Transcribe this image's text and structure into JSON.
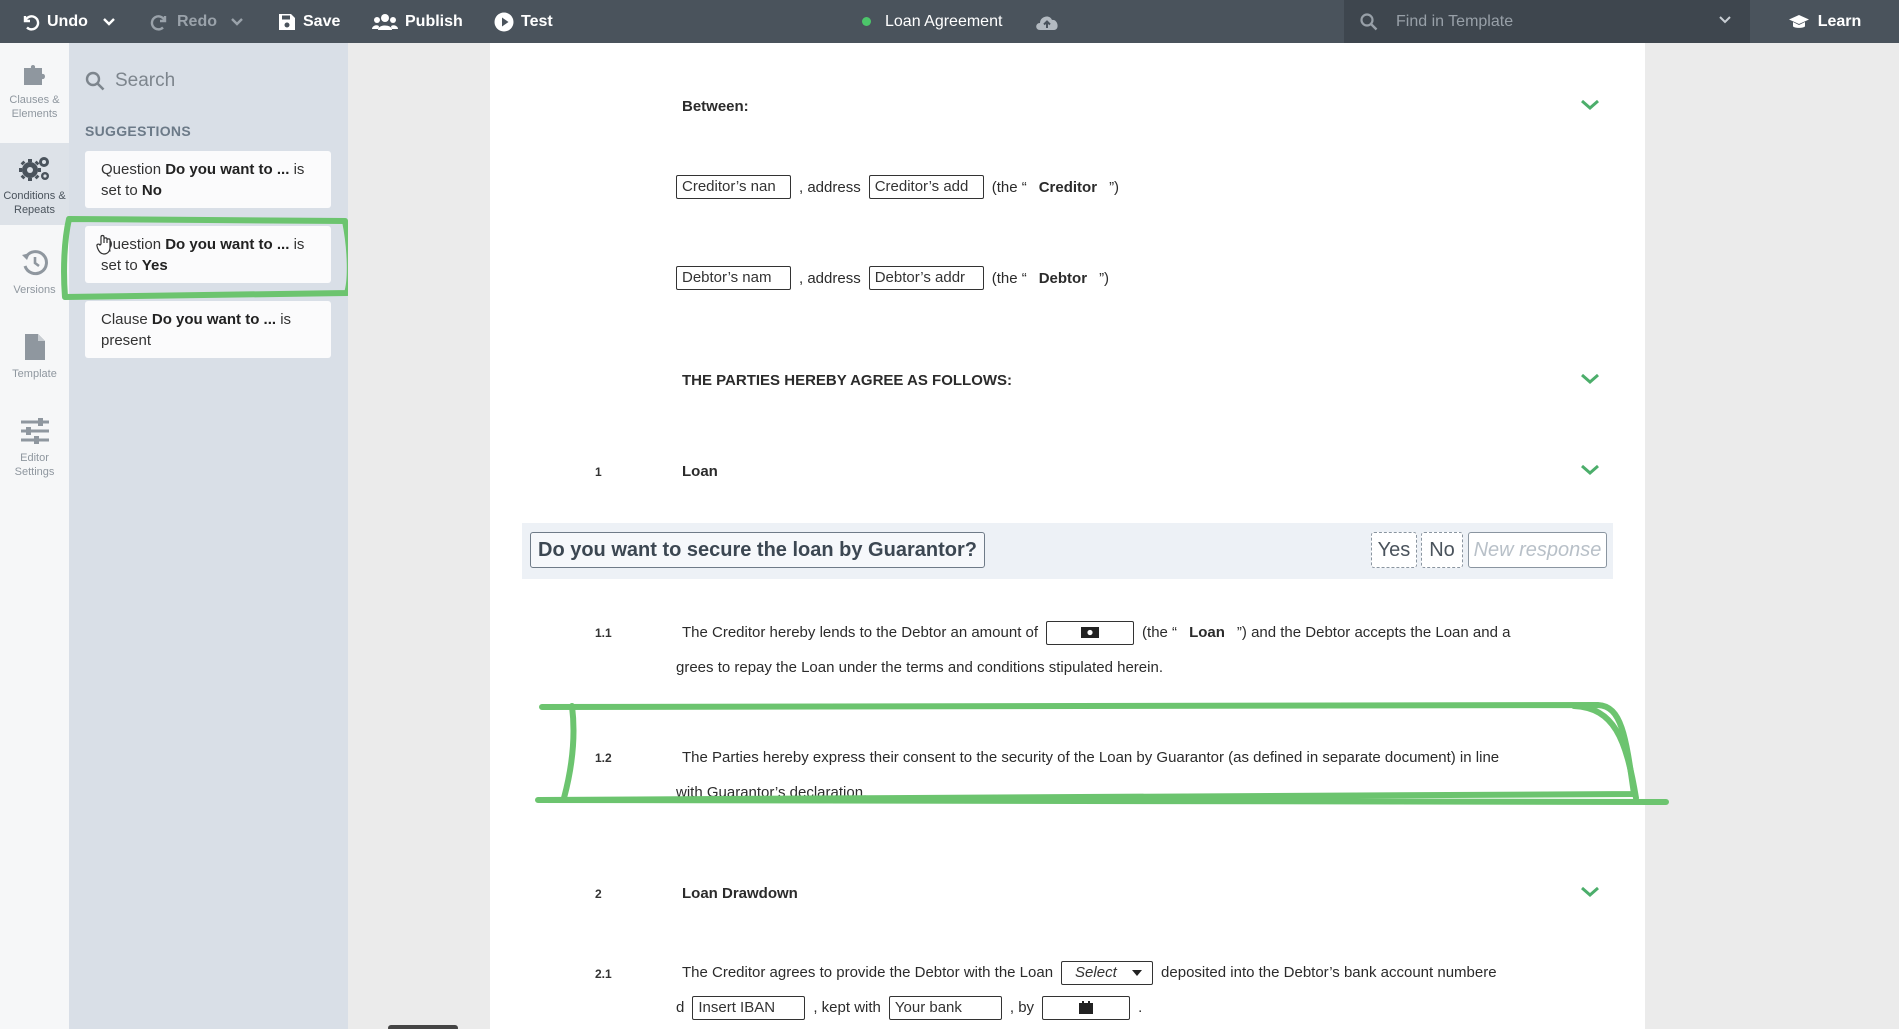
{
  "toolbar": {
    "undo": "Undo",
    "redo": "Redo",
    "save": "Save",
    "publish": "Publish",
    "test": "Test",
    "document_title": "Loan Agreement",
    "find_placeholder": "Find in Template",
    "learn": "Learn"
  },
  "rail": {
    "clauses": "Clauses & Elements",
    "conditions": "Conditions & Repeats",
    "versions": "Versions",
    "template": "Template",
    "editor_settings": "Editor Settings"
  },
  "panel": {
    "search_placeholder": "Search",
    "heading": "SUGGESTIONS",
    "suggestions": [
      {
        "kind": "Question",
        "subject": "Do you want to ...",
        "verb": "is set to",
        "value": "No"
      },
      {
        "kind": "Question",
        "subject": "Do you want to ...",
        "verb": "is set to",
        "value": "Yes"
      },
      {
        "kind": "Clause",
        "subject": "Do you want to ...",
        "verb": "is present",
        "value": ""
      }
    ]
  },
  "document": {
    "between": "Between:",
    "creditor_line": {
      "name_field": "Creditor’s nan",
      "address_label": ", address",
      "address_field": "Creditor’s add",
      "the_open": "(the “",
      "role": "Creditor",
      "the_close": "”)"
    },
    "debtor_line": {
      "name_field": "Debtor’s nam",
      "address_label": ", address",
      "address_field": "Debtor’s addr",
      "the_open": "(the “",
      "role": "Debtor",
      "the_close": "”)"
    },
    "parties_heading": "THE PARTIES HEREBY AGREE AS FOLLOWS:",
    "s1_number": "1",
    "s1_title": "Loan",
    "question": "Do you want to secure the loan by Guarantor?",
    "answer_yes": "Yes",
    "answer_no": "No",
    "answer_new": "New response",
    "c11_number": "1.1",
    "c11_a": "The Creditor hereby lends to the Debtor an amount of",
    "c11_b": "(the “",
    "c11_loan": "Loan",
    "c11_c": "”) and the Debtor accepts the Loan and a",
    "c11_d": "grees to repay the Loan under the terms and conditions stipulated herein.",
    "c12_number": "1.2",
    "c12_a": "The Parties hereby express their consent to the security of the Loan by Guarantor (as defined in separate document) in line",
    "c12_b": "with Guarantor’s declaration.",
    "s2_number": "2",
    "s2_title": "Loan Drawdown",
    "c21_number": "2.1",
    "c21_a": "The Creditor agrees to provide the Debtor with the Loan",
    "c21_select": "Select",
    "c21_b": "deposited into the Debtor’s bank account numbere",
    "c21_d": "d",
    "c21_iban": "Insert IBAN",
    "c21_kept": ", kept with",
    "c21_bank": "Your bank",
    "c21_by": ", by",
    "c21_end": "."
  },
  "colors": {
    "topbar": "#4a535c",
    "panel": "#d9dfe7",
    "annotation": "#6cc46f",
    "status_dot": "#4cc56a"
  }
}
